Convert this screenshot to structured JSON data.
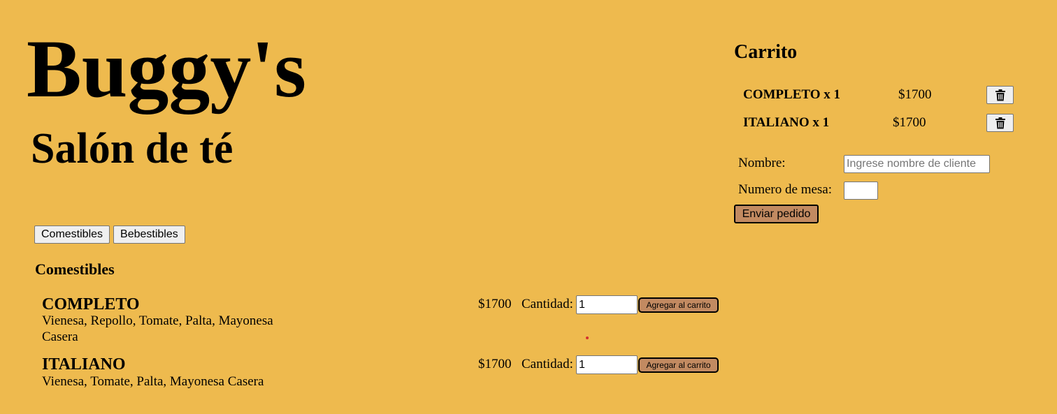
{
  "colors": {
    "background": "#EEBA4E",
    "action_button": "#C28A61",
    "neutral_button": "#EFEFEF",
    "indicator_dot": "#D32F2F"
  },
  "brand": {
    "title": "Buggy's",
    "subtitle": "Salón de té"
  },
  "tabs": [
    "Comestibles",
    "Bebestibles"
  ],
  "menu": {
    "section_title": "Comestibles",
    "quantity_label": "Cantidad:",
    "add_label": "Agregar al carrito",
    "products": [
      {
        "name": "COMPLETO",
        "description": "Vienesa, Repollo, Tomate, Palta, Mayonesa Casera",
        "price": "$1700",
        "quantity": "1"
      },
      {
        "name": "ITALIANO",
        "description": "Vienesa, Tomate, Palta, Mayonesa Casera",
        "price": "$1700",
        "quantity": "1"
      }
    ]
  },
  "cart": {
    "title": "Carrito",
    "delete_icon": "trash-icon",
    "items": [
      {
        "label": "COMPLETO x 1",
        "price": "$1700"
      },
      {
        "label": "ITALIANO x 1",
        "price": "$1700"
      }
    ],
    "form": {
      "name_label": "Nombre:",
      "name_placeholder": "Ingrese nombre de cliente",
      "name_value": "",
      "table_label": "Numero de mesa:",
      "table_value": "",
      "submit_label": "Enviar pedido"
    }
  }
}
